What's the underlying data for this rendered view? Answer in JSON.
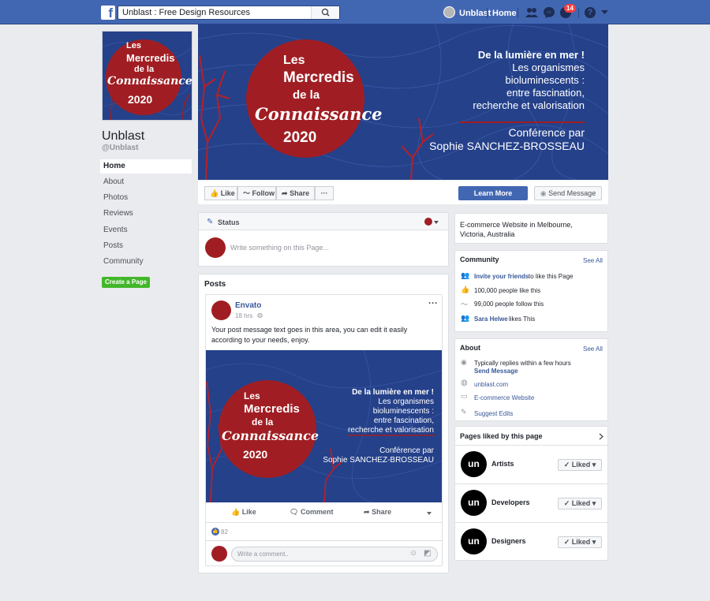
{
  "topbar": {
    "search_value": "Unblast : Free Design Resources",
    "user_name": "Unblast",
    "home_label": "Home",
    "notification_count": "14"
  },
  "page": {
    "name": "Unblast",
    "handle": "@Unblast"
  },
  "left_nav": {
    "items": [
      "Home",
      "About",
      "Photos",
      "Reviews",
      "Events",
      "Posts",
      "Community"
    ],
    "create_page_label": "Create a Page"
  },
  "cover": {
    "les": "Les",
    "mercredis": "Mercredis",
    "dela": "de la",
    "connaissance": "Connaissance",
    "year": "2020",
    "headline": "De la lumière en mer !",
    "line1": "Les organismes",
    "line2": "bioluminescents :",
    "line3": "entre fascination,",
    "line4": "recherche et valorisation",
    "conf": "Conférence par",
    "speaker": "Sophie SANCHEZ-BROSSEAU"
  },
  "profile_pic": {
    "les": "Les",
    "mercredis": "Mercredis",
    "dela": "de la",
    "connaissance": "Connaissance",
    "year": "2020"
  },
  "action_bar": {
    "like": "Like",
    "follow": "Follow",
    "share": "Share",
    "more": "···",
    "learn_more": "Learn More",
    "send_message": "Send Message"
  },
  "composer": {
    "status_label": "Status",
    "placeholder": "Write something on this Page..."
  },
  "posts": {
    "section_title": "Posts",
    "author": "Envato",
    "time": "18 hrs",
    "text": "Your post message text goes in this area, you can edit it easily according to your needs, enjoy.",
    "like": "Like",
    "comment": "Comment",
    "share": "Share",
    "reaction_count": "82",
    "comment_placeholder": "Write a comment.."
  },
  "right": {
    "category": "E-commerce Website in Melbourne, Victoria, Australia",
    "community": {
      "title": "Community",
      "see_all": "See All",
      "invite_link": "Invite your friends",
      "invite_rest": "to like this Page",
      "likes": "100,000 people like this",
      "follows": "99,000 people follow this",
      "friend_name": "Sara Helwe",
      "friend_rest": "likes This"
    },
    "about": {
      "title": "About",
      "see_all": "See All",
      "replies": "Typically replies within a few hours",
      "send_message": "Send Message",
      "website": "unblast.com",
      "category": "E-commerce Website",
      "suggest": "Suggest Edits"
    },
    "pages_liked": {
      "title": "Pages liked by this page",
      "items": [
        {
          "name": "Artists",
          "button": "Liked"
        },
        {
          "name": "Developers",
          "button": "Liked"
        },
        {
          "name": "Designers",
          "button": "Liked"
        }
      ],
      "logo_text": "un"
    }
  },
  "colors": {
    "fb_blue": "#4267b2",
    "cover_blue": "#25418a",
    "brand_red": "#a01e23",
    "green": "#42b72a"
  }
}
